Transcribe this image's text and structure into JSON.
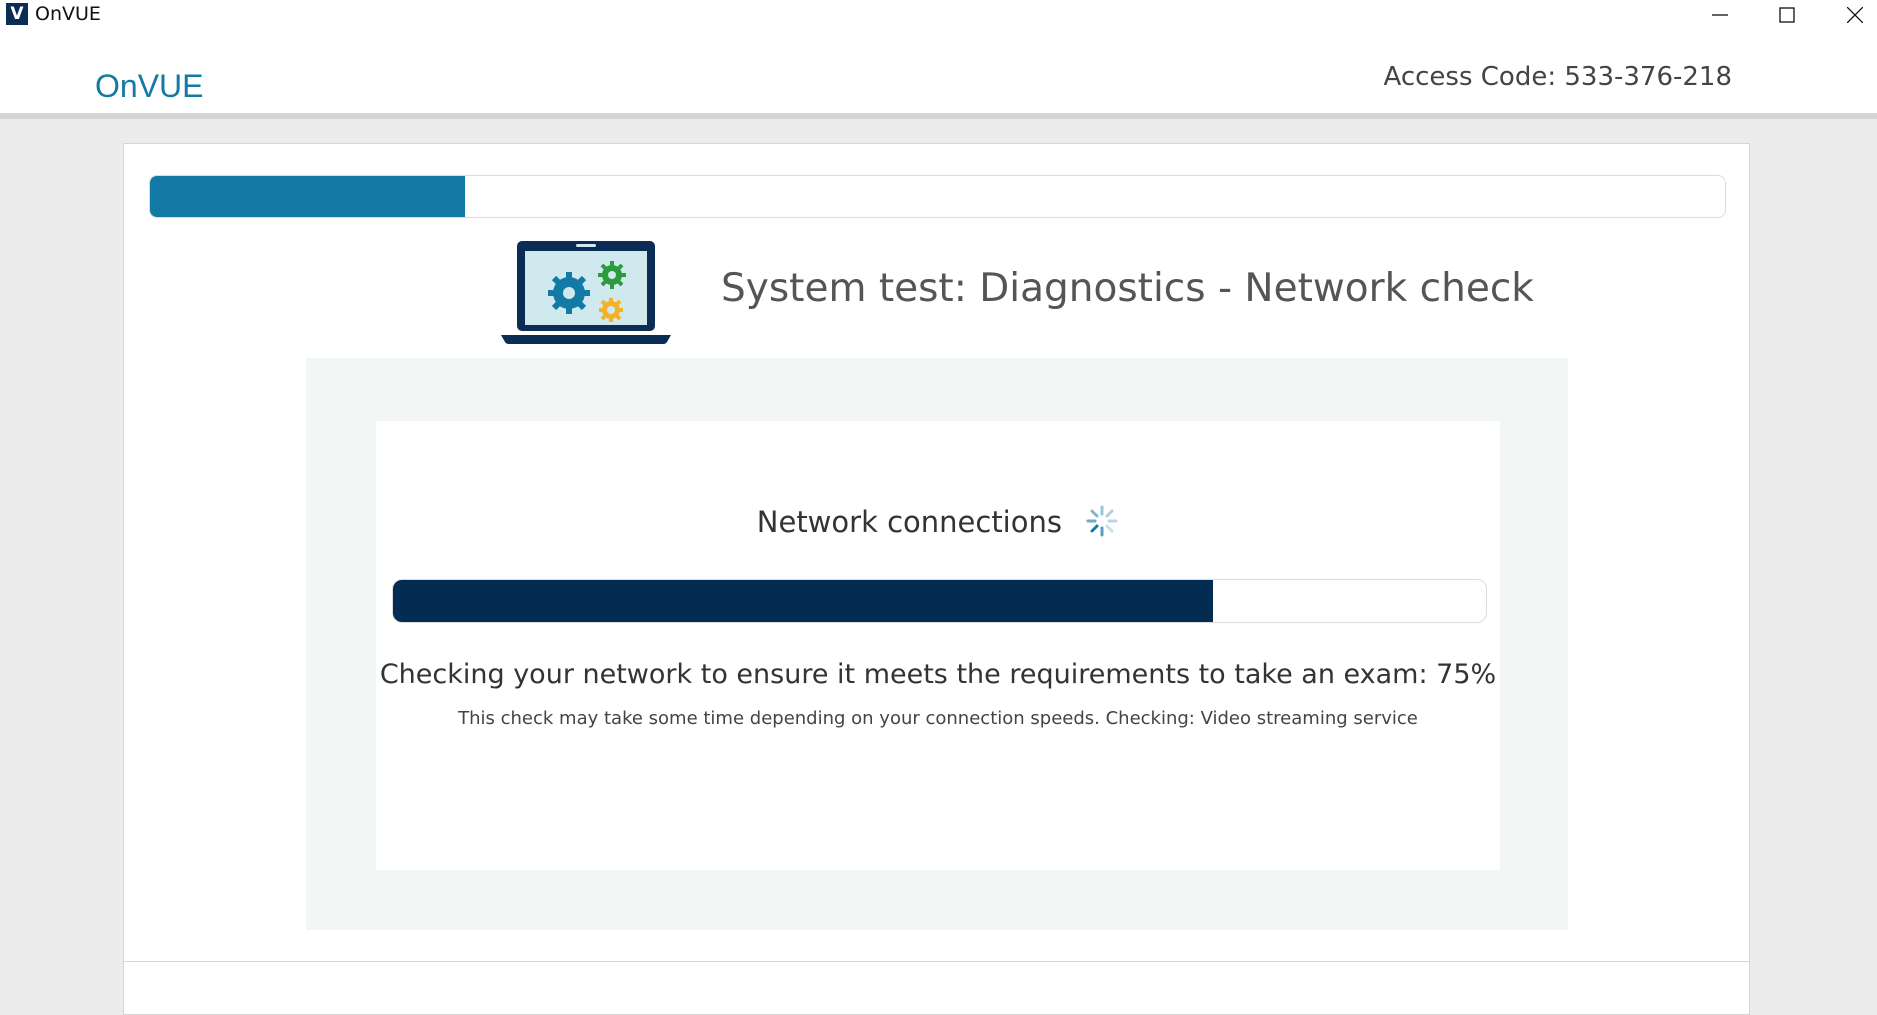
{
  "window": {
    "icon_letter": "V",
    "title": "OnVUE"
  },
  "header": {
    "logo_text": "OnVUE",
    "access_code": "Access Code: 533-376-218"
  },
  "overall_progress": {
    "fraction": 0.2
  },
  "page_title": "System test: Diagnostics - Network check",
  "network_check": {
    "heading": "Network connections",
    "progress_fraction": 0.75,
    "status_text": "Checking your network to ensure it meets the requirements to take an exam: 75%",
    "detail_text": "This check may take some time depending on your connection speeds. Checking: Video streaming service"
  },
  "colors": {
    "overall_progress": "#137aa5",
    "network_progress": "#042b52",
    "brand_navy": "#0b2c55",
    "brand_teal": "#137aa5"
  }
}
